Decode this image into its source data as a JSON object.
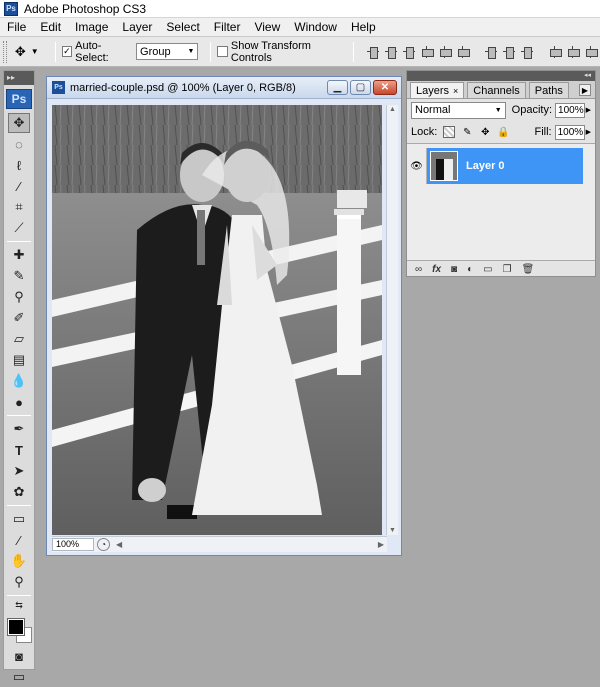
{
  "app": {
    "title": "Adobe Photoshop CS3",
    "logo": "Ps"
  },
  "menu": [
    "File",
    "Edit",
    "Image",
    "Layer",
    "Select",
    "Filter",
    "View",
    "Window",
    "Help"
  ],
  "options_bar": {
    "auto_select_label": "Auto-Select:",
    "auto_select_checked": true,
    "auto_select_value": "Group",
    "transform_label": "Show Transform Controls",
    "transform_checked": false
  },
  "document": {
    "title": "married-couple.psd @ 100% (Layer 0, RGB/8)",
    "zoom": "100%"
  },
  "layers_panel": {
    "tabs": [
      "Layers",
      "Channels",
      "Paths"
    ],
    "blend_mode": "Normal",
    "opacity_label": "Opacity:",
    "opacity_value": "100%",
    "lock_label": "Lock:",
    "fill_label": "Fill:",
    "fill_value": "100%",
    "layer_name": "Layer 0"
  },
  "colors": {
    "accent": "#3e95f5",
    "foreground": "#000000",
    "background": "#ffffff"
  },
  "icons": {
    "tools": [
      "move-icon",
      "marquee-icon",
      "lasso-icon",
      "magic-wand-icon",
      "crop-icon",
      "slice-icon",
      "healing-brush-icon",
      "brush-icon",
      "clone-stamp-icon",
      "history-brush-icon",
      "eraser-icon",
      "gradient-icon",
      "blur-icon",
      "dodge-icon",
      "pen-icon",
      "type-icon",
      "path-selection-icon",
      "shape-icon",
      "notes-icon",
      "eyedropper-icon",
      "hand-icon",
      "zoom-icon"
    ]
  }
}
